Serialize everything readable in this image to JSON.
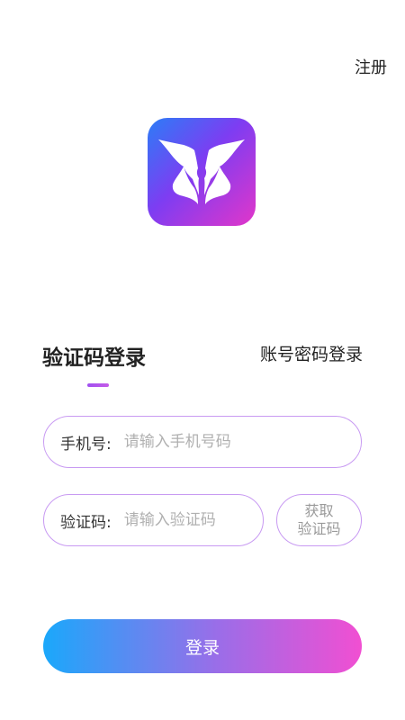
{
  "header": {
    "register_label": "注册"
  },
  "logo": {
    "icon": "butterfly-faces-logo",
    "gradient": [
      "#2b7df7",
      "#7d3df2",
      "#e236c9"
    ]
  },
  "tabs": {
    "sms_login_label": "验证码登录",
    "password_login_label": "账号密码登录",
    "active": "sms_login"
  },
  "form": {
    "phone_label": "手机号:",
    "phone_placeholder": "请输入手机号码",
    "phone_value": "",
    "code_label": "验证码:",
    "code_placeholder": "请输入验证码",
    "code_value": "",
    "get_code_line1": "获取",
    "get_code_line2": "验证码",
    "border_color": "#c89af2"
  },
  "login_button": {
    "label": "登录",
    "gradient": [
      "#1aa8fb",
      "#9b6de8",
      "#f14fd2"
    ]
  }
}
